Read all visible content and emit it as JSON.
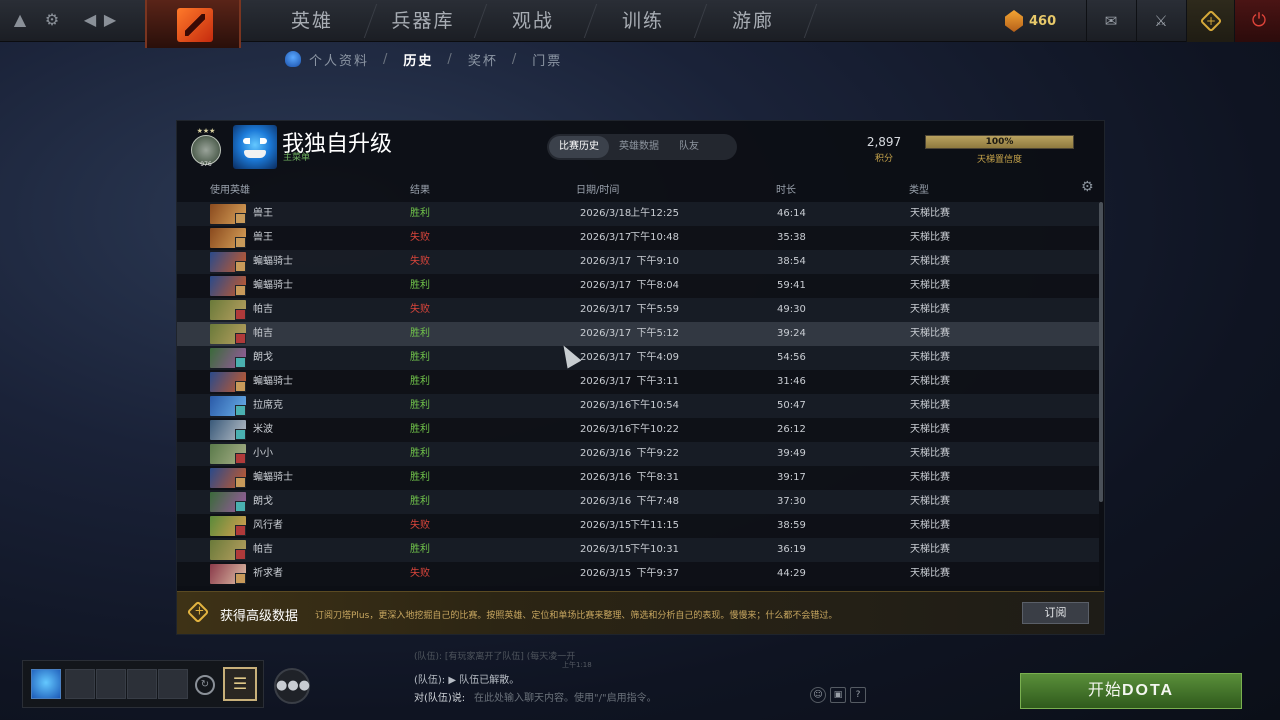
{
  "topbar": {
    "nav_tabs": [
      "英雄",
      "兵器库",
      "观战",
      "训练",
      "游廊"
    ],
    "shards": "460"
  },
  "subnav": {
    "items": [
      "个人资料",
      "历史",
      "奖杯",
      "门票"
    ],
    "active": "历史"
  },
  "profile": {
    "name": "我独自升级",
    "subtitle": "主菜单",
    "rank_number": "976",
    "mmr": "2,897",
    "mmr_label": "积分",
    "confidence_pct": "100%",
    "confidence_fraction": 1.0,
    "confidence_label": "天梯置信度"
  },
  "tabs": [
    "比赛历史",
    "英雄数据",
    "队友"
  ],
  "table": {
    "headers": [
      "使用英雄",
      "结果",
      "日期/时间",
      "时长",
      "类型"
    ],
    "rows": [
      {
        "hero": "兽王",
        "result": "胜利",
        "win": true,
        "date": "2026/3/18",
        "time": "上午12:25",
        "duration": "46:14",
        "type": "天梯比赛",
        "c1": "#8a4a1e",
        "c2": "#d9a35a",
        "badge": "#c89a5a"
      },
      {
        "hero": "兽王",
        "result": "失败",
        "win": false,
        "date": "2026/3/17",
        "time": "下午10:48",
        "duration": "35:38",
        "type": "天梯比赛",
        "c1": "#8a4a1e",
        "c2": "#d9a35a",
        "badge": "#c89a5a"
      },
      {
        "hero": "蝙蝠骑士",
        "result": "失败",
        "win": false,
        "date": "2026/3/17",
        "time": "下午9:10",
        "duration": "38:54",
        "type": "天梯比赛",
        "c1": "#2a4a8a",
        "c2": "#c85a2a",
        "badge": "#c89a5a"
      },
      {
        "hero": "蝙蝠骑士",
        "result": "胜利",
        "win": true,
        "date": "2026/3/17",
        "time": "下午8:04",
        "duration": "59:41",
        "type": "天梯比赛",
        "c1": "#2a4a8a",
        "c2": "#c85a2a",
        "badge": "#c89a5a"
      },
      {
        "hero": "帕吉",
        "result": "失败",
        "win": false,
        "date": "2026/3/17",
        "time": "下午5:59",
        "duration": "49:30",
        "type": "天梯比赛",
        "c1": "#6a7a3a",
        "c2": "#b8a060",
        "badge": "#b03a3a"
      },
      {
        "hero": "帕吉",
        "result": "胜利",
        "win": true,
        "date": "2026/3/17",
        "time": "下午5:12",
        "duration": "39:24",
        "type": "天梯比赛",
        "c1": "#6a7a3a",
        "c2": "#b8a060",
        "badge": "#b03a3a"
      },
      {
        "hero": "朗戈",
        "result": "胜利",
        "win": true,
        "date": "2026/3/17",
        "time": "下午4:09",
        "duration": "54:56",
        "type": "天梯比赛",
        "c1": "#3a6a3a",
        "c2": "#9a5aa0",
        "badge": "#4ab0b0"
      },
      {
        "hero": "蝙蝠骑士",
        "result": "胜利",
        "win": true,
        "date": "2026/3/17",
        "time": "下午3:11",
        "duration": "31:46",
        "type": "天梯比赛",
        "c1": "#2a4a8a",
        "c2": "#c85a2a",
        "badge": "#c89a5a"
      },
      {
        "hero": "拉席克",
        "result": "胜利",
        "win": true,
        "date": "2026/3/16",
        "time": "下午10:54",
        "duration": "50:47",
        "type": "天梯比赛",
        "c1": "#2a5aa8",
        "c2": "#6ab0e8",
        "badge": "#4ab0b0"
      },
      {
        "hero": "米波",
        "result": "胜利",
        "win": true,
        "date": "2026/3/16",
        "time": "下午10:22",
        "duration": "26:12",
        "type": "天梯比赛",
        "c1": "#3a5a7a",
        "c2": "#b8c0c8",
        "badge": "#4ab0b0"
      },
      {
        "hero": "小小",
        "result": "胜利",
        "win": true,
        "date": "2026/3/16",
        "time": "下午9:22",
        "duration": "39:49",
        "type": "天梯比赛",
        "c1": "#5a7a4a",
        "c2": "#a8b088",
        "badge": "#b03a3a"
      },
      {
        "hero": "蝙蝠骑士",
        "result": "胜利",
        "win": true,
        "date": "2026/3/16",
        "time": "下午8:31",
        "duration": "39:17",
        "type": "天梯比赛",
        "c1": "#2a4a8a",
        "c2": "#c85a2a",
        "badge": "#c89a5a"
      },
      {
        "hero": "朗戈",
        "result": "胜利",
        "win": true,
        "date": "2026/3/16",
        "time": "下午7:48",
        "duration": "37:30",
        "type": "天梯比赛",
        "c1": "#3a6a3a",
        "c2": "#9a5aa0",
        "badge": "#4ab0b0"
      },
      {
        "hero": "风行者",
        "result": "失败",
        "win": false,
        "date": "2026/3/15",
        "time": "下午11:15",
        "duration": "38:59",
        "type": "天梯比赛",
        "c1": "#5a8a3a",
        "c2": "#d8a050",
        "badge": "#b03a3a"
      },
      {
        "hero": "帕吉",
        "result": "胜利",
        "win": true,
        "date": "2026/3/15",
        "time": "下午10:31",
        "duration": "36:19",
        "type": "天梯比赛",
        "c1": "#6a7a3a",
        "c2": "#b8a060",
        "badge": "#b03a3a"
      },
      {
        "hero": "祈求者",
        "result": "失败",
        "win": false,
        "date": "2026/3/15",
        "time": "下午9:37",
        "duration": "44:29",
        "type": "天梯比赛",
        "c1": "#8a3a4a",
        "c2": "#e0c0a8",
        "badge": "#c89a5a"
      }
    ]
  },
  "plus_banner": {
    "title": "获得高级数据",
    "description": "订阅刀塔Plus，更深入地挖掘自己的比赛。按照英雄、定位和单场比赛来整理、筛选和分析自己的表现。慢慢来；什么都不会错过。",
    "button": "订阅"
  },
  "chat": {
    "faded_line": "(队伍):  [有玩家离开了队伍]  (每天凌一开",
    "faded_time": "上午1:18",
    "message": "(队伍): ▶ 队伍已解散。",
    "label": "对(队伍)说:",
    "placeholder": "在此处输入聊天内容。使用\"/\"启用指令。",
    "help": "?"
  },
  "play_button": {
    "prefix": "开始",
    "word": "DOTA"
  },
  "colors": {
    "win": "#70c24a",
    "loss": "#d9453b",
    "accent_gold": "#c7a44b",
    "play_green": "#4a7f2e"
  }
}
